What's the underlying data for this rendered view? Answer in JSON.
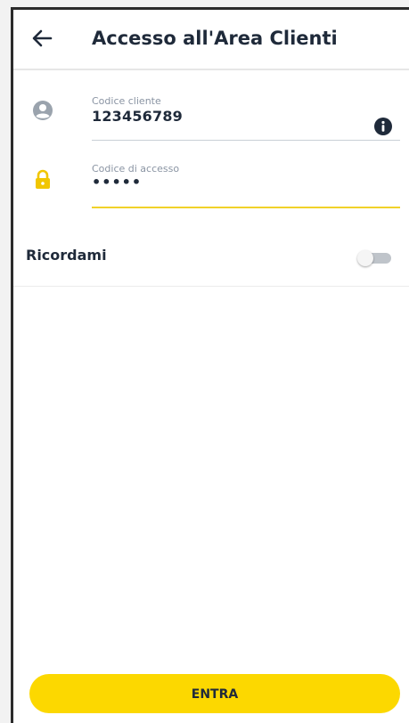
{
  "header": {
    "title": "Accesso all'Area Clienti",
    "back_icon": "arrow-left-icon"
  },
  "form": {
    "customer_code": {
      "label": "Codice cliente",
      "value": "123456789",
      "icon": "account-circle-icon",
      "info_icon": "info-icon"
    },
    "access_code": {
      "label": "Codice di accesso",
      "value": "•••••",
      "icon": "lock-icon"
    }
  },
  "remember": {
    "label": "Ricordami",
    "enabled": false
  },
  "actions": {
    "enter_label": "ENTRA"
  },
  "colors": {
    "accent": "#fcd800",
    "text": "#1f2a3a",
    "muted": "#8a94a3"
  }
}
